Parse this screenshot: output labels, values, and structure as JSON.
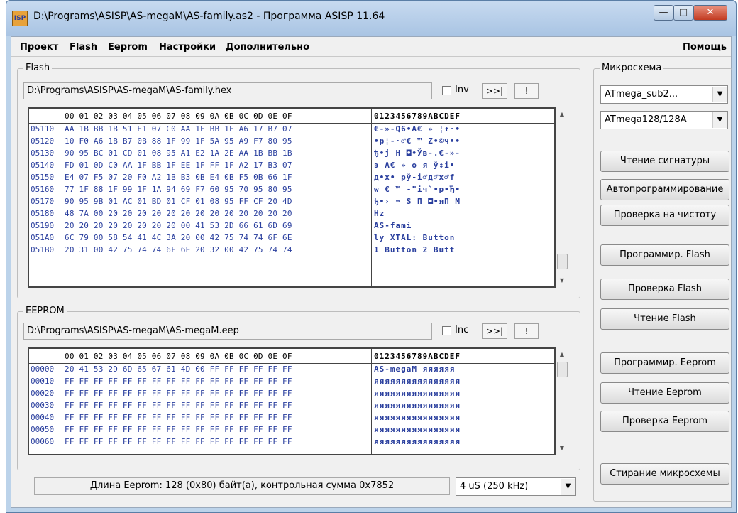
{
  "window": {
    "title": "D:\\Programs\\ASISP\\AS-megaM\\AS-family.as2 - Программа ASISP 11.64",
    "icon_text": "ISP"
  },
  "menu": {
    "items": [
      "Проект",
      "Flash",
      "Eeprom",
      "Настройки",
      "Дополнительно"
    ],
    "help": "Помощь"
  },
  "flash": {
    "group_title": "Flash",
    "path": "D:\\Programs\\ASISP\\AS-megaM\\AS-family.hex",
    "inv_label": "Inv",
    "next_button": ">>|",
    "warn_button": "!",
    "header_bytes": "00 01 02 03 04 05 06 07 08 09 0A 0B 0C 0D 0E 0F",
    "header_ascii": "0123456789ABCDEF",
    "rows": [
      {
        "addr": "05110",
        "bytes": "AA 1B BB 1B 51 E1 07 C0 AA 1F BB 1F A6 17 B7 07",
        "ascii": "€-»-Q6•А€ » ¦↑·•"
      },
      {
        "addr": "05120",
        "bytes": "10 F0 A6 1B B7 0B 88 1F 99 1F 5A 95 A9 F7 80 95",
        "ascii": "•р¦-·♂€ ™ Z•©ч••"
      },
      {
        "addr": "05130",
        "bytes": "90 95 BC 01 CD 01 08 95 A1 E2 1A 2E AA 1B BB 1B",
        "ascii": "ђ•ј Н ◘•Ўв-.€-»-"
      },
      {
        "addr": "05140",
        "bytes": "FD 01 0D C0 AA 1F BB 1F EE 1F FF 1F A2 17 B3 07",
        "ascii": "э  А€ » о я ў↕і•"
      },
      {
        "addr": "05150",
        "bytes": "E4 07 F5 07 20 F0 A2 1B B3 0B E4 0B F5 0B 66 1F",
        "ascii": "д•х• рў-і♂д♂х♂f "
      },
      {
        "addr": "05160",
        "bytes": "77 1F 88 1F 99 1F 1A 94 69 F7 60 95 70 95 80 95",
        "ascii": "w € ™ -\"iч`•p•Ђ•"
      },
      {
        "addr": "05170",
        "bytes": "90 95 9B 01 AC 01 BD 01 CF 01 08 95 FF CF 20 4D",
        "ascii": "ђ•› ¬ Ѕ П ◘•яП M"
      },
      {
        "addr": "05180",
        "bytes": "48 7A 00 20 20 20 20 20 20 20 20 20 20 20 20 20",
        "ascii": "Hz              "
      },
      {
        "addr": "05190",
        "bytes": "20 20 20 20 20 20 20 20 00 41 53 2D 66 61 6D 69",
        "ascii": "         AS-fami"
      },
      {
        "addr": "051A0",
        "bytes": "6C 79 00 58 54 41 4C 3A 20 00 42 75 74 74 6F 6E",
        "ascii": "ly XTAL: Button"
      },
      {
        "addr": "051B0",
        "bytes": "20 31 00 42 75 74 74 6F 6E 20 32 00 42 75 74 74",
        "ascii": " 1 Button 2 Butt"
      }
    ]
  },
  "eeprom": {
    "group_title": "EEPROM",
    "path": "D:\\Programs\\ASISP\\AS-megaM\\AS-megaM.eep",
    "inc_label": "Inc",
    "next_button": ">>|",
    "warn_button": "!",
    "header_bytes": "00 01 02 03 04 05 06 07 08 09 0A 0B 0C 0D 0E 0F",
    "header_ascii": "0123456789ABCDEF",
    "rows": [
      {
        "addr": "00000",
        "bytes": "20 41 53 2D 6D 65 67 61 4D 00 FF FF FF FF FF FF",
        "ascii": " AS-megaM яяяяяя"
      },
      {
        "addr": "00010",
        "bytes": "FF FF FF FF FF FF FF FF FF FF FF FF FF FF FF FF",
        "ascii": "яяяяяяяяяяяяяяяя"
      },
      {
        "addr": "00020",
        "bytes": "FF FF FF FF FF FF FF FF FF FF FF FF FF FF FF FF",
        "ascii": "яяяяяяяяяяяяяяяя"
      },
      {
        "addr": "00030",
        "bytes": "FF FF FF FF FF FF FF FF FF FF FF FF FF FF FF FF",
        "ascii": "яяяяяяяяяяяяяяяя"
      },
      {
        "addr": "00040",
        "bytes": "FF FF FF FF FF FF FF FF FF FF FF FF FF FF FF FF",
        "ascii": "яяяяяяяяяяяяяяяя"
      },
      {
        "addr": "00050",
        "bytes": "FF FF FF FF FF FF FF FF FF FF FF FF FF FF FF FF",
        "ascii": "яяяяяяяяяяяяяяяя"
      },
      {
        "addr": "00060",
        "bytes": "FF FF FF FF FF FF FF FF FF FF FF FF FF FF FF FF",
        "ascii": "яяяяяяяяяяяяяяяя"
      }
    ]
  },
  "chip": {
    "group_title": "Микросхема",
    "family_select": "ATmega_sub2...",
    "device_select": "ATmega128/128A"
  },
  "buttons": {
    "read_signature": "Чтение сигнатуры",
    "autoprogram": "Автопрограммирование",
    "blank_check": "Проверка на чистоту",
    "program_flash": "Программир. Flash",
    "verify_flash": "Проверка Flash",
    "read_flash": "Чтение Flash",
    "program_eeprom": "Программир. Eeprom",
    "read_eeprom": "Чтение Eeprom",
    "verify_eeprom": "Проверка Eeprom",
    "erase_chip": "Стирание микросхемы"
  },
  "status": {
    "text": "Длина Eeprom: 128 (0x80) байт(а), контрольная сумма 0x7852",
    "speed_select": "4 uS (250 kHz)"
  }
}
